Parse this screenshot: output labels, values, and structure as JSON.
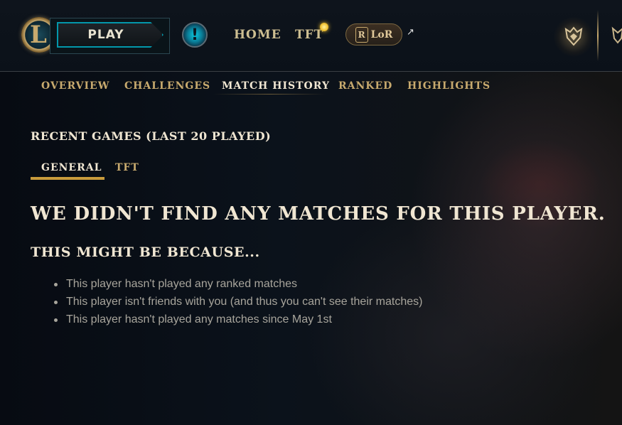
{
  "header": {
    "play_label": "PLAY",
    "nav": {
      "home": "HOME",
      "tft": "TFT",
      "lor": "LoR",
      "lor_badge_letter": "R"
    },
    "icons": [
      "league-logo-icon",
      "alert-icon",
      "notification-dot-icon",
      "lor-icon",
      "external-link-icon",
      "clash-trophy-icon",
      "ranked-crest-icon"
    ],
    "alert_glyph": "!",
    "external_glyph": "↗"
  },
  "subnav": {
    "tabs": [
      {
        "label": "OVERVIEW",
        "active": false
      },
      {
        "label": "CHALLENGES",
        "active": false
      },
      {
        "label": "MATCH HISTORY",
        "active": true
      },
      {
        "label": "RANKED",
        "active": false
      },
      {
        "label": "HIGHLIGHTS",
        "active": false
      }
    ]
  },
  "main": {
    "section_title": "RECENT GAMES (LAST 20 PLAYED)",
    "mode_tabs": [
      {
        "label": "GENERAL",
        "active": true
      },
      {
        "label": "TFT",
        "active": false
      }
    ],
    "empty_headline": "WE DIDN'T FIND ANY MATCHES FOR THIS PLAYER.",
    "reason_heading": "THIS MIGHT BE BECAUSE...",
    "reasons": [
      "This player hasn't played any ranked matches",
      "This player isn't friends with you (and thus you can't see their matches)",
      "This player hasn't played any matches since May 1st"
    ]
  },
  "colors": {
    "gold": "#c8aa6e",
    "cream": "#f0e6d2",
    "teal": "#0397ab",
    "accent_underline": "#c89b3c",
    "body_text": "#a8a59c"
  }
}
